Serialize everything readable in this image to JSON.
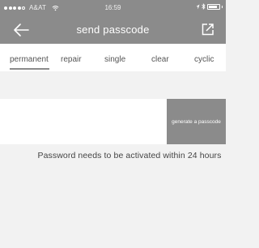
{
  "status_bar": {
    "carrier": "A&AT",
    "time": "16:59",
    "signal_icon": "signal-dots-icon",
    "wifi_icon": "wifi-icon",
    "bluetooth_icon": "bluetooth-icon",
    "location_icon": "location-arrow-icon",
    "battery_icon": "battery-icon"
  },
  "nav": {
    "title": "send passcode",
    "back_icon": "arrow-left-icon",
    "share_icon": "share-icon"
  },
  "tabs": [
    {
      "label": "permanent",
      "active": true
    },
    {
      "label": "repair",
      "active": false
    },
    {
      "label": "single",
      "active": false
    },
    {
      "label": "clear",
      "active": false
    },
    {
      "label": "cyclic",
      "active": false
    }
  ],
  "form": {
    "passcode_value": "",
    "generate_label": "generate a passcode"
  },
  "notice": "Password needs to be activated within 24 hours",
  "colors": {
    "header_bg": "#8b8b8b",
    "page_bg": "#f2f2f2",
    "button_bg": "#8b8b8b"
  }
}
